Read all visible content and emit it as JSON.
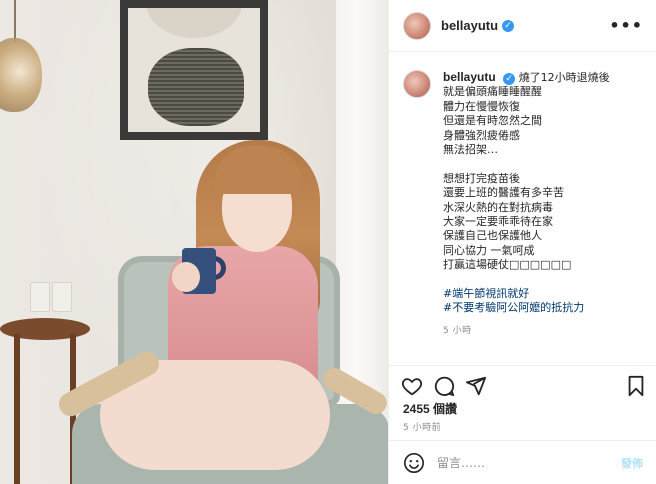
{
  "post": {
    "username": "bellayutu",
    "more_label": "•••",
    "caption_lines": [
      "燒了12小時退燒後",
      "就是偏頭痛睡睡醒醒",
      "體力在慢慢恢復",
      "但還是有時忽然之間",
      "身體強烈疲倦感",
      "無法招架…",
      "",
      "想想打完疫苗後",
      "還要上班的醫護有多辛苦",
      "水深火熱的在對抗病毒",
      "大家一定要乖乖待在家",
      "保護自己也保護他人",
      "同心協力 一氣呵成",
      "打贏這場硬仗□□□□□□"
    ],
    "hashtags": [
      "#端午節視訊就好",
      "#不要考驗阿公阿嬤的抵抗力"
    ],
    "caption_time": "5 小時",
    "likes": "2455 個讚",
    "timestamp": "5 小時前",
    "comment_placeholder": "留言……",
    "post_button": "發佈"
  },
  "icons": {
    "verified": "verified-badge-icon",
    "like": "heart-icon",
    "comment": "comment-icon",
    "share": "share-icon",
    "save": "bookmark-icon",
    "emoji": "emoji-icon"
  },
  "colors": {
    "verified": "#3897f0",
    "hashtag": "#00376b",
    "muted": "#8e8e8e"
  }
}
